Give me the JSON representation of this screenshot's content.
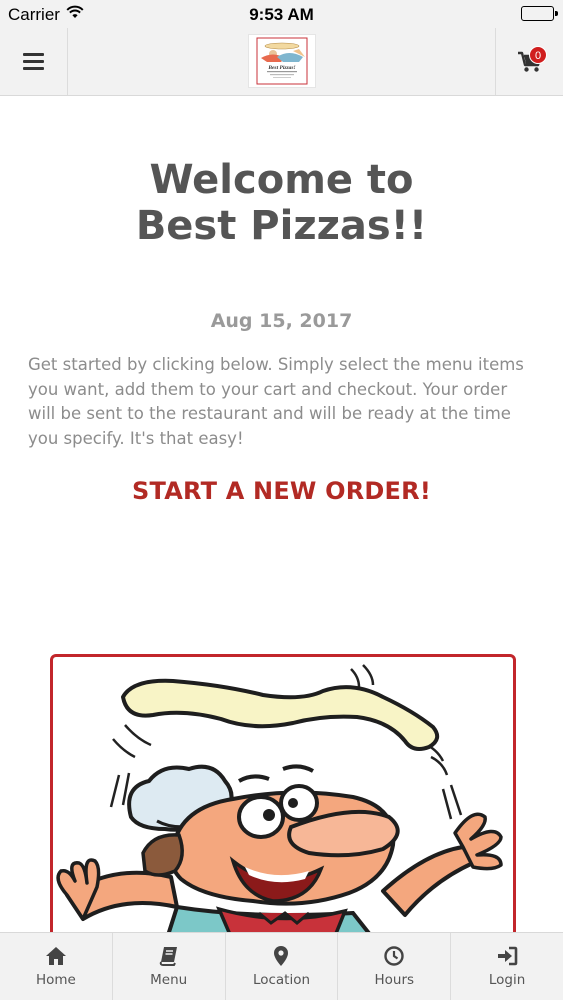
{
  "status_bar": {
    "carrier": "Carrier",
    "time": "9:53 AM"
  },
  "navbar": {
    "menu_icon": "hamburger-icon",
    "logo_alt": "Best Pizzas!",
    "logo_text": "Best Pizzas!",
    "cart_icon": "cart-icon",
    "cart_count": "0"
  },
  "main": {
    "welcome_line1": "Welcome to",
    "welcome_line2": "Best Pizzas!!",
    "date": "Aug 15, 2017",
    "intro": "Get started by clicking below. Simply select the menu items you want, add them to your cart and checkout. Your order will be sent to the restaurant and will be ready at the time you specify. It's that easy!",
    "cta": "START A NEW ORDER!"
  },
  "tabs": [
    {
      "label": "Home",
      "icon": "home-icon"
    },
    {
      "label": "Menu",
      "icon": "book-icon"
    },
    {
      "label": "Location",
      "icon": "map-pin-icon"
    },
    {
      "label": "Hours",
      "icon": "clock-icon"
    },
    {
      "label": "Login",
      "icon": "login-icon"
    }
  ],
  "colors": {
    "accent": "#b22a24",
    "badge": "#d01e1e",
    "heading": "#555555",
    "body_text": "#8c8c8c",
    "bar_bg": "#f2f2f2"
  }
}
